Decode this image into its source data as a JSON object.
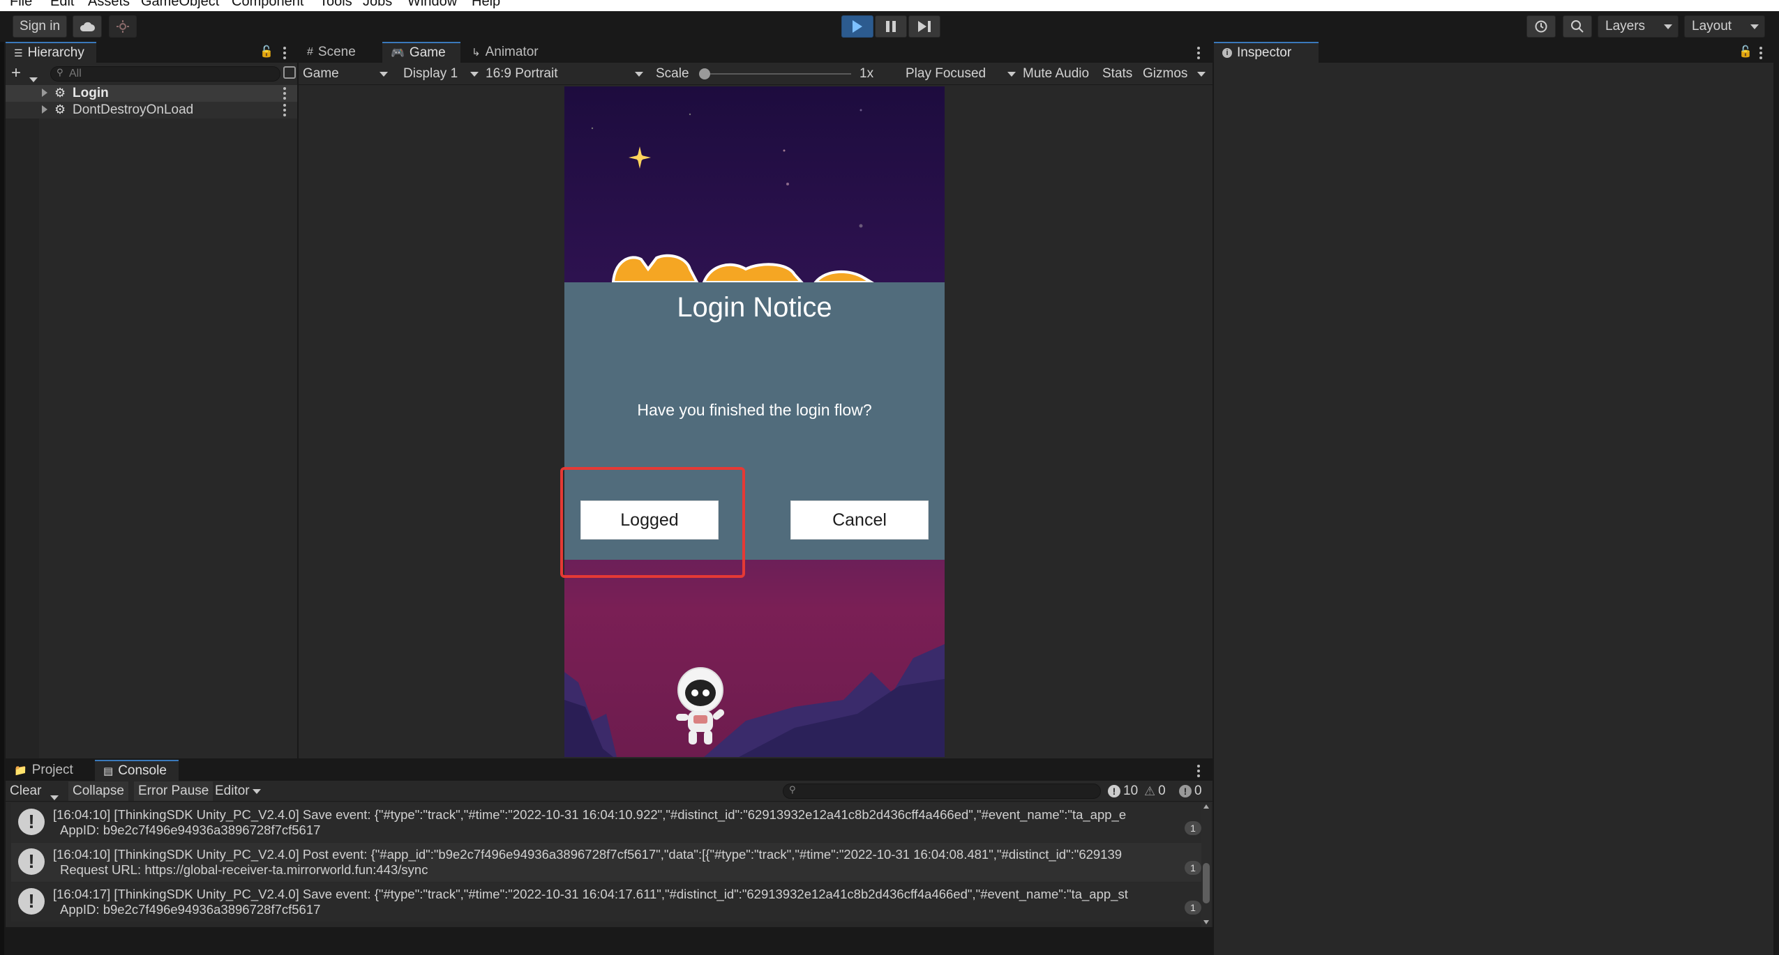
{
  "menu": [
    "File",
    "Edit",
    "Assets",
    "GameObject",
    "Component",
    "Tools",
    "Jobs",
    "Window",
    "Help"
  ],
  "toolbar": {
    "sign_in": "Sign in",
    "layers": "Layers",
    "layout": "Layout"
  },
  "hierarchy": {
    "tab": "Hierarchy",
    "search_placeholder": "All",
    "items": [
      "Login",
      "DontDestroyOnLoad"
    ]
  },
  "center_tabs": [
    "Scene",
    "Game",
    "Animator"
  ],
  "game_toolbar": {
    "view": "Game",
    "display": "Display 1",
    "aspect": "16:9 Portrait",
    "scale_label": "Scale",
    "scale_value": "1x",
    "scale_level": 0.0,
    "play_mode": "Play Focused",
    "mute": "Mute Audio",
    "stats": "Stats",
    "gizmos": "Gizmos"
  },
  "dialog": {
    "title": "Login Notice",
    "message": "Have you finished the login flow?",
    "confirm": "Logged",
    "cancel": "Cancel"
  },
  "inspector": {
    "tab": "Inspector"
  },
  "bottom_tabs": [
    "Project",
    "Console"
  ],
  "console_toolbar": {
    "clear": "Clear",
    "collapse": "Collapse",
    "error_pause": "Error Pause",
    "editor": "Editor",
    "search_placeholder": "",
    "log_count": "10",
    "warn_count": "0",
    "error_count": "0"
  },
  "console_logs": [
    {
      "line1": "[16:04:10] [ThinkingSDK Unity_PC_V2.4.0] Save event: {\"#type\":\"track\",\"#time\":\"2022-10-31 16:04:10.922\",\"#distinct_id\":\"62913932e12a41c8b2d436cff4a466ed\",\"#event_name\":\"ta_app_e",
      "line2": "AppID: b9e2c7f496e94936a3896728f7cf5617",
      "count": "1"
    },
    {
      "line1": "[16:04:10] [ThinkingSDK Unity_PC_V2.4.0] Post event: {\"#app_id\":\"b9e2c7f496e94936a3896728f7cf5617\",\"data\":[{\"#type\":\"track\",\"#time\":\"2022-10-31 16:04:08.481\",\"#distinct_id\":\"629139",
      "line2": "Request URL: https://global-receiver-ta.mirrorworld.fun:443/sync",
      "count": "1"
    },
    {
      "line1": "[16:04:17] [ThinkingSDK Unity_PC_V2.4.0] Save event: {\"#type\":\"track\",\"#time\":\"2022-10-31 16:04:17.611\",\"#distinct_id\":\"62913932e12a41c8b2d436cff4a466ed\",\"#event_name\":\"ta_app_st",
      "line2": "AppID: b9e2c7f496e94936a3896728f7cf5617",
      "count": "1"
    }
  ],
  "colors": {
    "accent": "#3a79bb",
    "highlight": "#e53935",
    "dialog_bg": "#516c7c"
  }
}
